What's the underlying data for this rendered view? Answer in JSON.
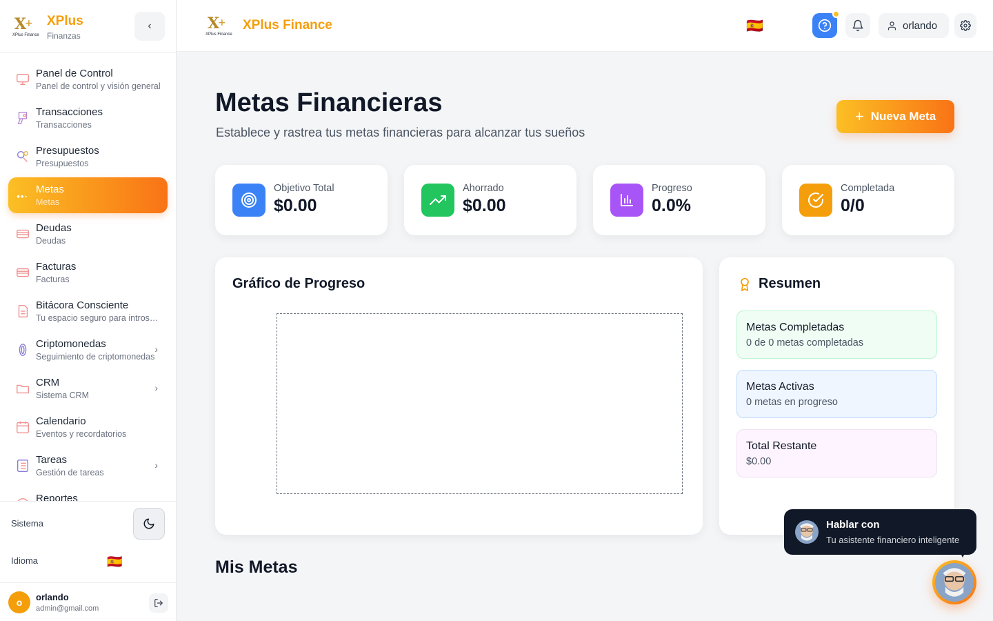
{
  "app": {
    "brand": "XPlus",
    "brand_sub": "Finanzas",
    "full_brand": "XPlus Finance",
    "logo_text": "XPlus Finance",
    "accent": "#f59e0b"
  },
  "sidebar": {
    "items": [
      {
        "label": "Panel de Control",
        "desc": "Panel de control y visión general",
        "icon": "dashboard-icon"
      },
      {
        "label": "Transacciones",
        "desc": "Transacciones",
        "icon": "transactions-icon"
      },
      {
        "label": "Presupuestos",
        "desc": "Presupuestos",
        "icon": "budget-icon"
      },
      {
        "label": "Metas",
        "desc": "Metas",
        "icon": "goals-icon",
        "active": true
      },
      {
        "label": "Deudas",
        "desc": "Deudas",
        "icon": "card-icon"
      },
      {
        "label": "Facturas",
        "desc": "Facturas",
        "icon": "card-icon"
      },
      {
        "label": "Bitácora Consciente",
        "desc": "Tu espacio seguro para introspección",
        "icon": "document-icon"
      },
      {
        "label": "Criptomonedas",
        "desc": "Seguimiento de criptomonedas",
        "icon": "crypto-icon",
        "chevron": true
      },
      {
        "label": "CRM",
        "desc": "Sistema CRM",
        "icon": "folder-icon",
        "chevron": true
      },
      {
        "label": "Calendario",
        "desc": "Eventos y recordatorios",
        "icon": "calendar-icon"
      },
      {
        "label": "Tareas",
        "desc": "Gestión de tareas",
        "icon": "tasks-icon",
        "chevron": true
      },
      {
        "label": "Reportes",
        "desc": "",
        "icon": "reports-icon"
      }
    ],
    "system_label": "Sistema",
    "language_label": "Idioma",
    "language_flag": "🇪🇸",
    "user": {
      "initial": "o",
      "name": "orlando",
      "email": "admin@gmail.com"
    }
  },
  "topbar": {
    "flag": "🇪🇸",
    "user_name": "orlando"
  },
  "page": {
    "title": "Metas Financieras",
    "subtitle": "Establece y rastrea tus metas financieras para alcanzar tus sueños",
    "new_button": "Nueva Meta"
  },
  "stats": [
    {
      "label": "Objetivo Total",
      "value": "$0.00",
      "color": "#3b82f6",
      "icon": "target-icon"
    },
    {
      "label": "Ahorrado",
      "value": "$0.00",
      "color": "#22c55e",
      "icon": "trending-up-icon"
    },
    {
      "label": "Progreso",
      "value": "0.0%",
      "color": "#a855f7",
      "icon": "bar-chart-icon"
    },
    {
      "label": "Completada",
      "value": "0/0",
      "color": "#f59e0b",
      "icon": "check-circle-icon"
    }
  ],
  "chart": {
    "title": "Gráfico de Progreso"
  },
  "summary": {
    "title": "Resumen",
    "items": [
      {
        "title": "Metas Completadas",
        "desc": "0 de 0 metas completadas",
        "bg": "#f0fdf4",
        "border": "#bbf7d0"
      },
      {
        "title": "Metas Activas",
        "desc": "0 metas en progreso",
        "bg": "#eff6ff",
        "border": "#bfdbfe"
      },
      {
        "title": "Total Restante",
        "desc": "$0.00",
        "bg": "#fdf4ff",
        "border": "#f0e1f5"
      }
    ]
  },
  "goals_section": {
    "title": "Mis Metas"
  },
  "chat": {
    "title": "Hablar con",
    "subtitle": "Tu asistente financiero inteligente"
  }
}
